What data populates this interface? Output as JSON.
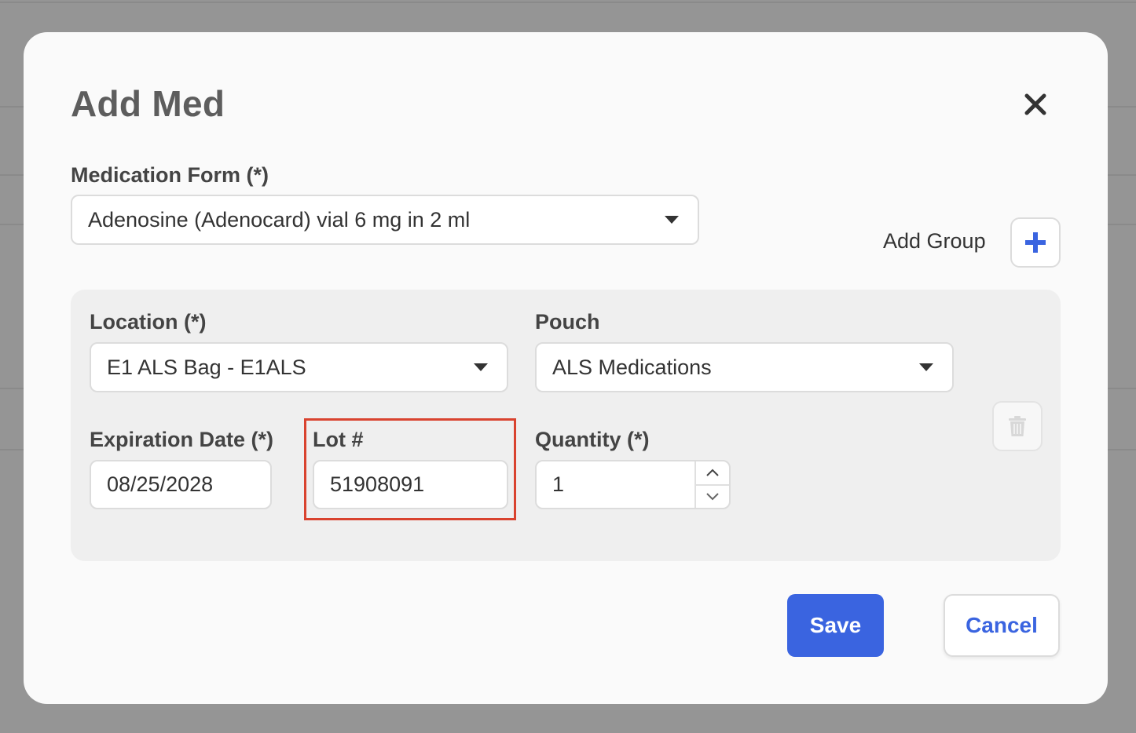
{
  "dialog": {
    "title": "Add Med"
  },
  "medication_form": {
    "label": "Medication Form (*)",
    "value": "Adenosine (Adenocard) vial 6 mg in 2 ml"
  },
  "add_group": {
    "label": "Add Group"
  },
  "group": {
    "location": {
      "label": "Location (*)",
      "value": "E1 ALS Bag - E1ALS"
    },
    "pouch": {
      "label": "Pouch",
      "value": "ALS Medications"
    },
    "expiration": {
      "label": "Expiration Date (*)",
      "value": "08/25/2028"
    },
    "lot": {
      "label": "Lot #",
      "value": "51908091"
    },
    "quantity": {
      "label": "Quantity (*)",
      "value": "1"
    }
  },
  "footer": {
    "save_label": "Save",
    "cancel_label": "Cancel"
  },
  "colors": {
    "primary": "#3a64e0",
    "highlight": "#d9432f",
    "panel": "#efefef",
    "overlay": "#959595"
  },
  "icons": {
    "close": "close-icon",
    "add": "plus-icon",
    "delete": "trash-icon",
    "dropdown": "caret-down-icon",
    "increment": "chevron-up-icon",
    "decrement": "chevron-down-icon"
  }
}
